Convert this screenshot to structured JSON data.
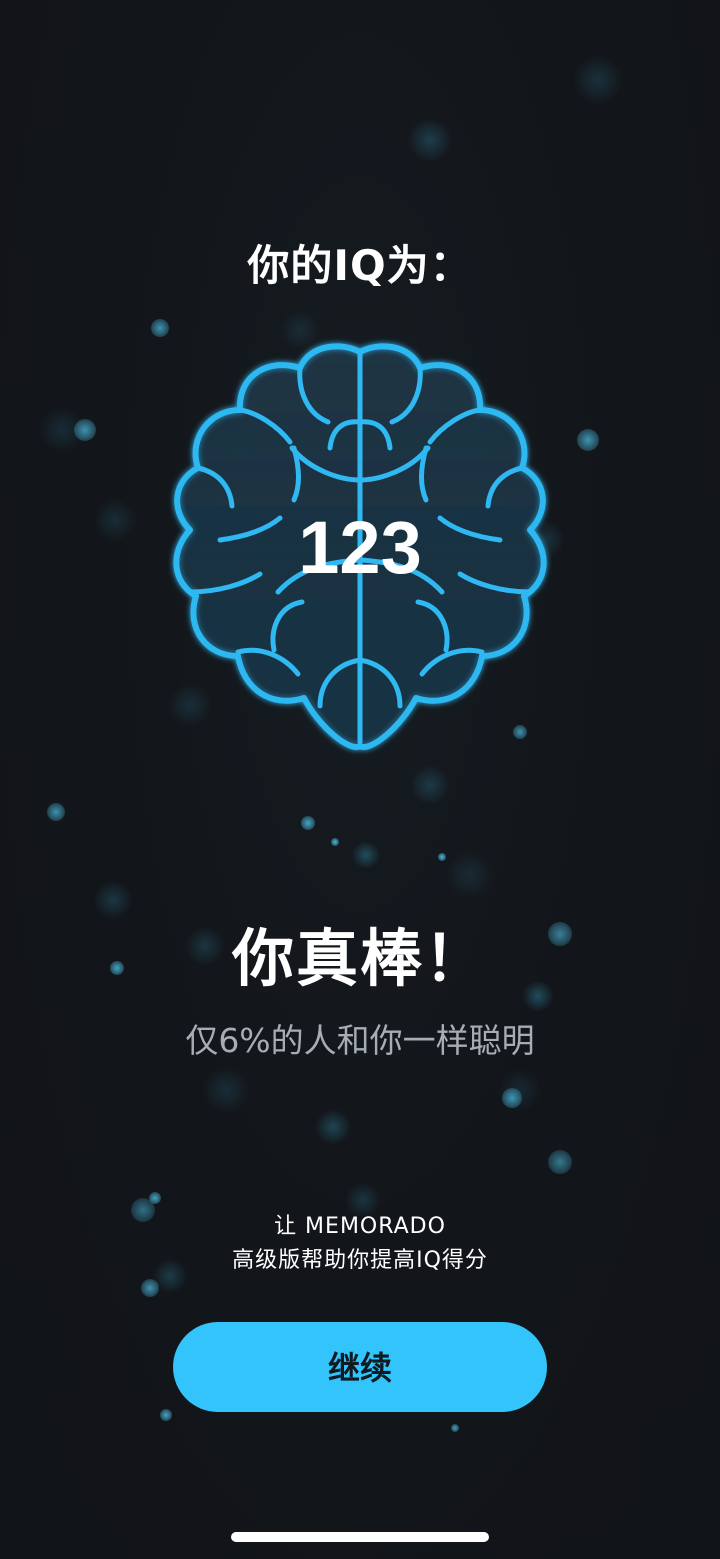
{
  "result": {
    "title": "你的IQ为：",
    "iq_score": "123",
    "headline": "你真棒！",
    "subtitle": "仅6%的人和你一样聪明"
  },
  "promo": {
    "line1": "让 MEMORADO",
    "line2": "高级版帮助你提高IQ得分"
  },
  "actions": {
    "continue_label": "继续"
  },
  "icons": {
    "brain": "brain-icon"
  },
  "colors": {
    "background": "#121519",
    "accent": "#33c4fb",
    "brain_outline": "#2fb8f2",
    "subtitle_text": "#a7adb5"
  }
}
